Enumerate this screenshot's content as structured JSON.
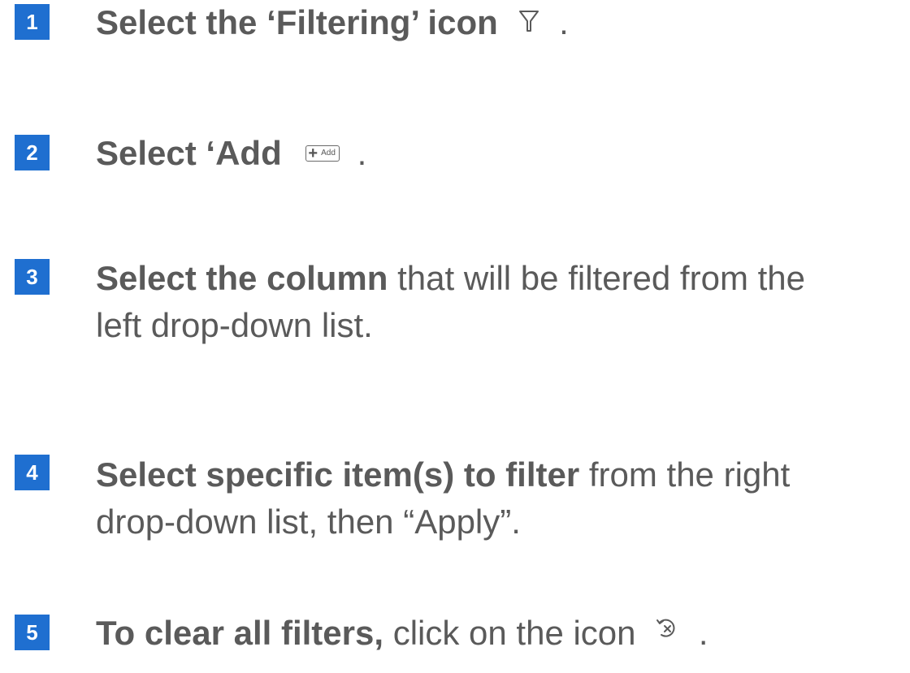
{
  "steps": [
    {
      "number": "1",
      "bold": "Select the ‘Filtering’ icon",
      "icon": "filter-funnel-icon",
      "after_icon": "."
    },
    {
      "number": "2",
      "bold": "Select ‘Add",
      "button_plus": "+",
      "button_label": "Add",
      "after_icon": "."
    },
    {
      "number": "3",
      "bold": "Select the column",
      "rest_line1": " that will be filtered from the",
      "rest_line2": "left drop-down list."
    },
    {
      "number": "4",
      "bold": "Select specific item(s) to filter",
      "rest_line1": " from the right",
      "rest_line2": "drop-down list, then “Apply”."
    },
    {
      "number": "5",
      "bold": "To clear all filters,",
      "rest_line1": " click on the icon",
      "icon": "clear-filters-icon",
      "after_icon": "."
    }
  ],
  "colors": {
    "badge": "#1f6fd0",
    "text": "#5a5a5a",
    "badge_text": "#ffffff"
  }
}
